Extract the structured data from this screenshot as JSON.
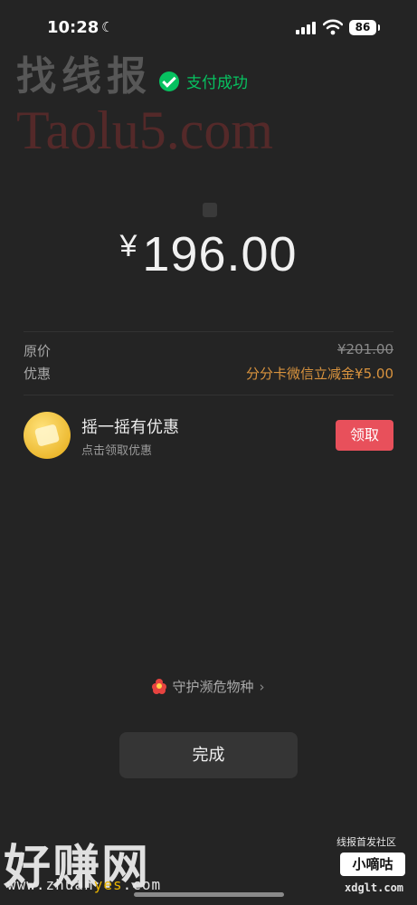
{
  "status_bar": {
    "time": "10:28",
    "battery": "86"
  },
  "watermarks": {
    "top_text": "找线报",
    "site": "Taolu5.com",
    "bottom_text": "好赚网",
    "bottom_url_pre": "www.zhuan",
    "bottom_url_hl": "yes",
    "bottom_url_post": ".com",
    "community": "线报首发社区",
    "badge": "小嘀咕",
    "badge_url": "xdglt.com"
  },
  "payment": {
    "status": "支付成功",
    "currency_symbol": "¥",
    "amount": "196.00"
  },
  "details": {
    "original_label": "原价",
    "original_value": "¥201.00",
    "discount_label": "优惠",
    "discount_value": "分分卡微信立减金¥5.00"
  },
  "promo": {
    "title": "摇一摇有优惠",
    "subtitle": "点击领取优惠",
    "button": "领取"
  },
  "protect": {
    "label": "守护濒危物种"
  },
  "done": {
    "label": "完成"
  },
  "colors": {
    "success_green": "#07c160",
    "discount_orange": "#d9933e",
    "claim_red": "#e8505b"
  }
}
